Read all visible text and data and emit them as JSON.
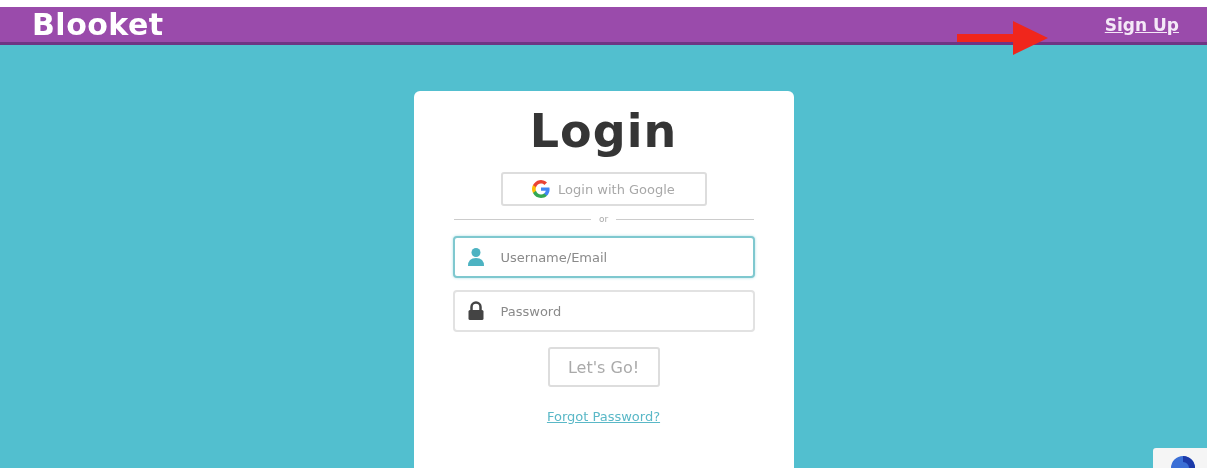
{
  "header": {
    "logo": "Blooket",
    "sign_up_link": "Sign Up"
  },
  "login_card": {
    "title": "Login",
    "google_button": "Login with Google",
    "divider": "or",
    "fields": [
      {
        "kind": "user",
        "placeholder": "Username/Email",
        "focused": true
      },
      {
        "kind": "lock",
        "placeholder": "Password",
        "focused": false
      }
    ],
    "submit_button": "Let's Go!",
    "forgot_link": "Forgot Password?"
  }
}
